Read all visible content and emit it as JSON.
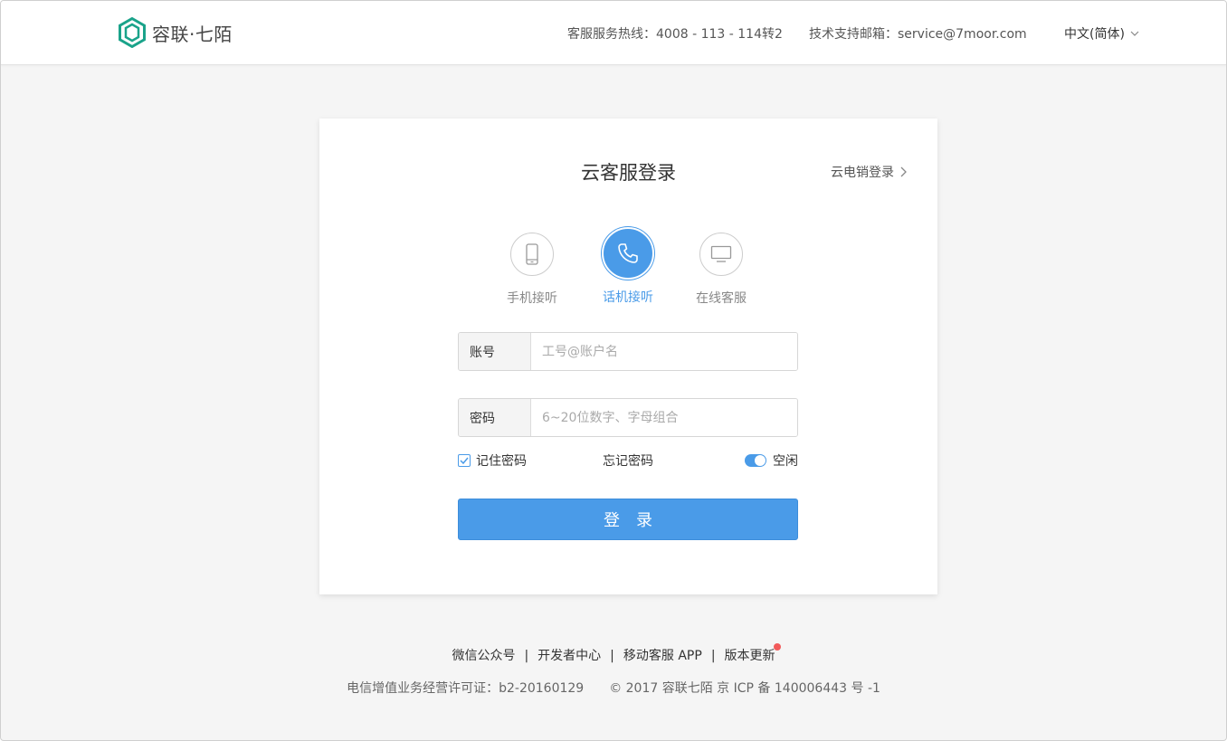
{
  "header": {
    "logo_text": "容联·七陌",
    "hotline": "客服服务热线：4008 - 113 - 114转2",
    "email": "技术支持邮箱：service@7moor.com",
    "language": "中文(简体)"
  },
  "login": {
    "title": "云客服登录",
    "alt_link": "云电销登录",
    "modes": [
      {
        "label": "手机接听",
        "icon": "mobile-phone-icon",
        "active": false
      },
      {
        "label": "话机接听",
        "icon": "telephone-icon",
        "active": true
      },
      {
        "label": "在线客服",
        "icon": "monitor-icon",
        "active": false
      }
    ],
    "account_label": "账号",
    "account_placeholder": "工号@账户名",
    "password_label": "密码",
    "password_placeholder": "6~20位数字、字母组合",
    "remember_label": "记住密码",
    "forgot_label": "忘记密码",
    "status_label": "空闲",
    "submit_label": "登录"
  },
  "footer": {
    "links": [
      "微信公众号",
      "开发者中心",
      "移动客服 APP",
      "版本更新"
    ],
    "license": "电信增值业务经营许可证：b2-20160129",
    "copyright": "© 2017 容联七陌 京 ICP 备 140006443 号 -1"
  },
  "colors": {
    "accent": "#4a9be8",
    "brand_green": "#1aa38a",
    "badge_red": "#f25b5b"
  }
}
